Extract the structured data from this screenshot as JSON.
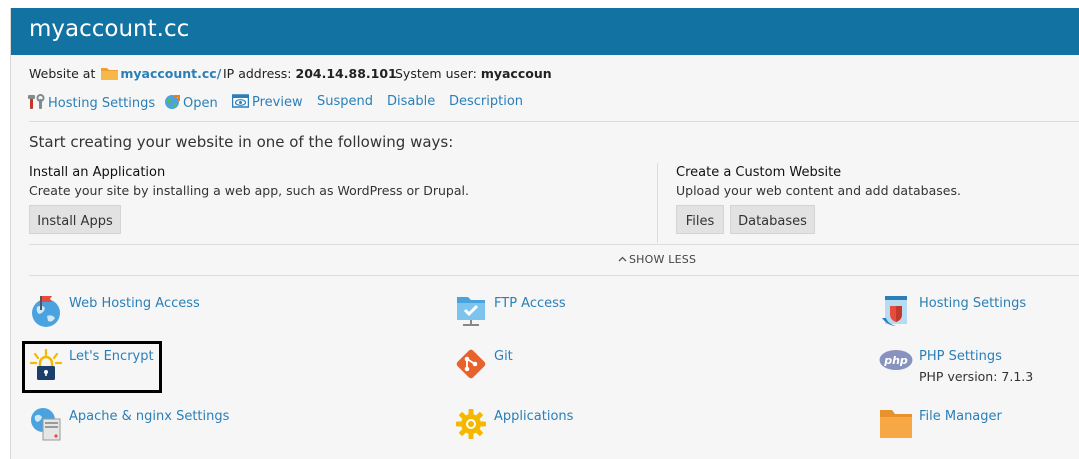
{
  "header": {
    "title": "myaccount.cc"
  },
  "info": {
    "website_label": "Website at",
    "website_link": "myaccount.cc/",
    "ip_label": "IP address:",
    "ip_value": "204.14.88.101",
    "sysuser_label": "System user:",
    "sysuser_value": "myaccoun"
  },
  "actions": [
    {
      "label": "Hosting Settings",
      "icon": "tools-icon"
    },
    {
      "label": "Open",
      "icon": "globe-icon"
    },
    {
      "label": "Preview",
      "icon": "preview-icon"
    },
    {
      "label": "Suspend"
    },
    {
      "label": "Disable"
    },
    {
      "label": "Description"
    }
  ],
  "start": {
    "heading": "Start creating your website in one of the following ways:",
    "install": {
      "title": "Install an Application",
      "desc": "Create your site by installing a web app, such as WordPress or Drupal.",
      "button": "Install Apps"
    },
    "custom": {
      "title": "Create a Custom Website",
      "desc": "Upload your web content and add databases.",
      "files_button": "Files",
      "databases_button": "Databases"
    },
    "show_less": "SHOW LESS"
  },
  "tools": [
    {
      "label": "Web Hosting Access",
      "icon": "web-hosting-access-icon"
    },
    {
      "label": "FTP Access",
      "icon": "ftp-access-icon"
    },
    {
      "label": "Hosting Settings",
      "icon": "hosting-settings-icon"
    },
    {
      "label": "Let's Encrypt",
      "icon": "lets-encrypt-icon"
    },
    {
      "label": "Git",
      "icon": "git-icon"
    },
    {
      "label": "PHP Settings",
      "sub": "PHP version: 7.1.3",
      "icon": "php-icon"
    },
    {
      "label": "Apache & nginx Settings",
      "icon": "apache-nginx-icon"
    },
    {
      "label": "Applications",
      "icon": "applications-gear-icon"
    },
    {
      "label": "File Manager",
      "icon": "file-manager-folder-icon"
    }
  ],
  "colors": {
    "header_bg": "#1273a3",
    "link": "#2a7fb8",
    "panel_bg": "#f6f6f6"
  }
}
